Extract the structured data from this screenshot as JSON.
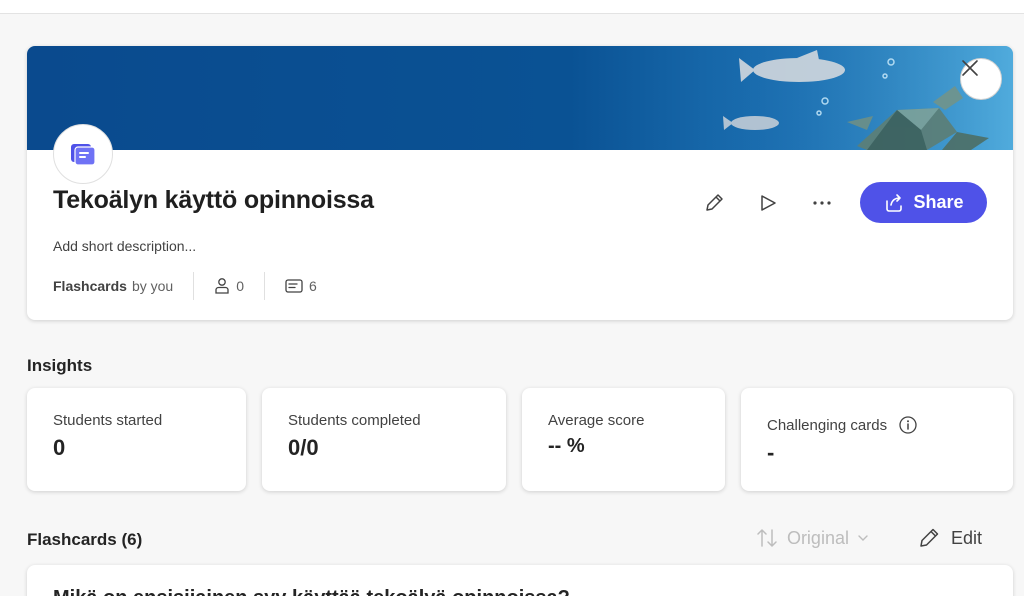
{
  "set": {
    "title": "Tekoälyn käyttö opinnoissa",
    "description": "Add short description...",
    "type_label": "Flashcards",
    "owner_label": "by you",
    "students_count": "0",
    "cards_count": "6",
    "share_label": "Share"
  },
  "icons": {
    "close": "close-icon",
    "badge": "flashcards-icon",
    "edit": "pencil-icon",
    "play": "play-icon",
    "more": "more-icon",
    "share": "share-icon",
    "students": "person-icon",
    "cards": "card-icon",
    "info": "info-icon",
    "sort": "sort-arrows-icon",
    "chevron": "chevron-down-icon"
  },
  "insights": {
    "title": "Insights",
    "cards": [
      {
        "label": "Students started",
        "value": "0"
      },
      {
        "label": "Students completed",
        "value": "0/0"
      },
      {
        "label": "Average score",
        "value": "-- %"
      },
      {
        "label": "Challenging cards",
        "value": "-"
      }
    ]
  },
  "flashcards": {
    "title": "Flashcards (6)",
    "sort_label": "Original",
    "edit_label": "Edit",
    "first_item": "Mikä on ensisijainen syy käyttää tekoälyä opinnoissa?"
  },
  "colors": {
    "accent": "#4f52e8",
    "banner": "#0a4a8e"
  }
}
